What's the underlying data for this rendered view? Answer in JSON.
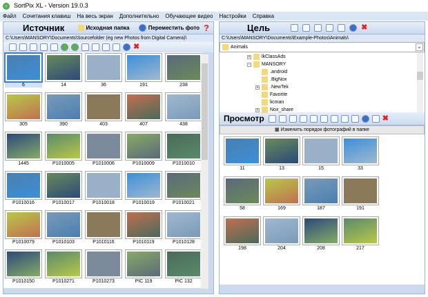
{
  "window": {
    "title": "SortPix XL - Version 19.0.3"
  },
  "menu": [
    "Файл",
    "Сочетания клавиш",
    "На весь экран",
    "Дополнительно",
    "Обучающее видео",
    "Настройки",
    "Справка"
  ],
  "source": {
    "title": "Источник",
    "source_folder": "Исходная папка",
    "move_photo": "Переместить фото",
    "help": "?",
    "path": "C:\\Users\\MANSORY\\Documents\\Sourcefolder (eg new Photos from Digital Camera)\\",
    "photos": [
      "6",
      "14",
      "36",
      "191",
      "238",
      "305",
      "390",
      "403",
      "407",
      "438",
      "1445",
      "P1010005",
      "P1010006",
      "P1010009",
      "P1010010",
      "P1010016",
      "P1010017",
      "P1010018",
      "P1010019",
      "P1010021",
      "P1010079",
      "P1010103",
      "P1010116",
      "P1010119",
      "P1010128",
      "P1010150",
      "P1010271",
      "P1010273",
      "PIC 119",
      "PIC 132"
    ],
    "selected": "6"
  },
  "target": {
    "title": "Цель",
    "path": "C:\\Users\\MANSORY\\Documents\\Example-Photos\\Animals\\",
    "folder": "Animals",
    "tree": [
      "lkClassAds",
      "MANSORY",
      ".android",
      ".BigNox",
      ".NewTek",
      "Favorite",
      "licman",
      "Nox_share"
    ]
  },
  "preview": {
    "title": "Просмотр",
    "reorder": "Изменить порядок фотографий в папке",
    "photos": [
      "11",
      "13",
      "15",
      "33",
      "58",
      "169",
      "187",
      "191",
      "198",
      "204",
      "208",
      "217"
    ]
  },
  "colors": {
    "accent": "#3a7bd5",
    "panel": "#c9d9ee",
    "delete": "#dd2222"
  }
}
